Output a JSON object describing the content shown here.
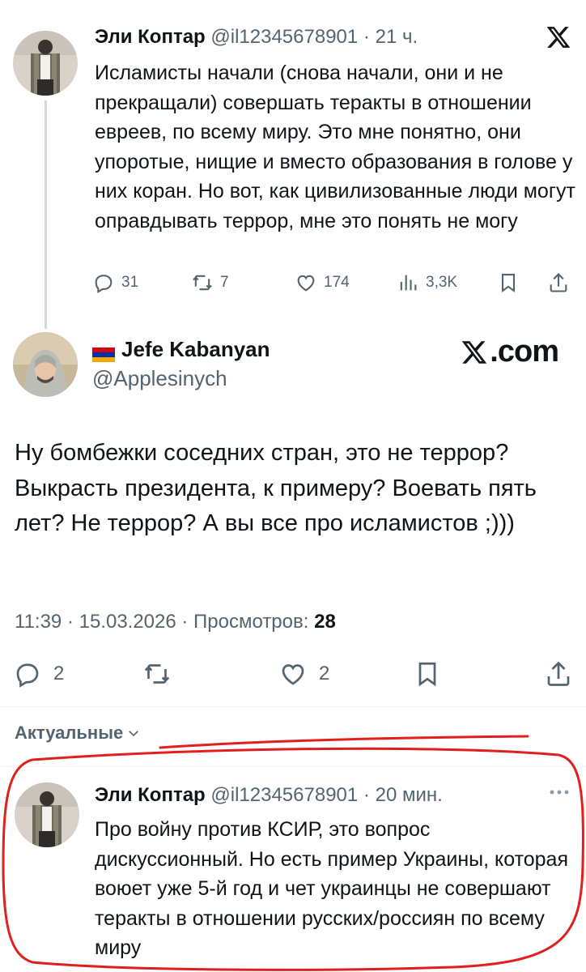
{
  "parent_tweet": {
    "author_name": "Эли Коптар",
    "handle": "@il12345678901",
    "separator": "·",
    "time": "21 ч.",
    "text": "Исламисты начали (снова начали, они и не прекращали) совершать теракты в отношении евреев, по всему миру. Это мне понятно, они упоротые, нищие и вместо образования в голове у них коран. Но вот, как цивилизованные люди могут оправдывать террор, мне это понять не могу",
    "actions": {
      "replies": "31",
      "reposts": "7",
      "likes": "174",
      "views": "3,3K"
    }
  },
  "main_tweet": {
    "author_name": "Jefe Kabanyan",
    "handle": "@Applesinych",
    "brand": ".com",
    "text": "Ну бомбежки соседних стран, это не террор? Выкрасть президента, к примеру? Воевать пять лет? Не террор? А вы все про исламистов ;)))",
    "timestamp": "11:39 · 15.03.2026 · Просмотров:",
    "views": "28",
    "actions": {
      "replies": "2",
      "likes": "2"
    }
  },
  "sort_label": "Актуальные",
  "reply_tweet": {
    "author_name": "Эли Коптар",
    "handle": "@il12345678901",
    "separator": "·",
    "time": "20 мин.",
    "more": "···",
    "text": "Про войну против КСИР, это вопрос дискуссионный. Но есть пример Украины, которая воюет уже 5-й год и чет украинцы не совершают теракты в отношении русских/россиян по всему миру"
  },
  "colors": {
    "text": "#0f1419",
    "secondary": "#536471",
    "thread_line": "#cfd9de",
    "annotation_red": "#e0201c"
  }
}
